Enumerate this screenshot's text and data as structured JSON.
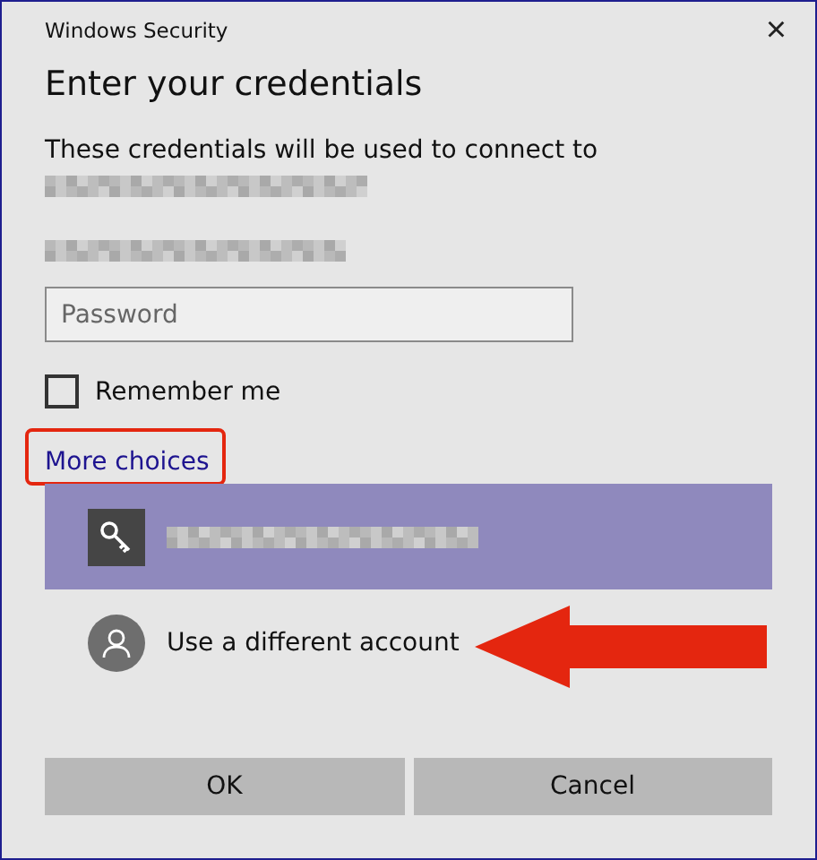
{
  "window": {
    "title": "Windows Security",
    "close": "×"
  },
  "heading": "Enter your credentials",
  "message": "These credentials will be used to connect to",
  "password": {
    "placeholder": "Password"
  },
  "remember": {
    "label": "Remember me",
    "checked": false
  },
  "more_choices": {
    "label": "More choices",
    "highlighted": true
  },
  "accounts": [
    {
      "kind": "key",
      "selected": true
    },
    {
      "kind": "person",
      "label": "Use a different account",
      "selected": false,
      "pointed": true
    }
  ],
  "buttons": [
    "OK",
    "Cancel"
  ]
}
